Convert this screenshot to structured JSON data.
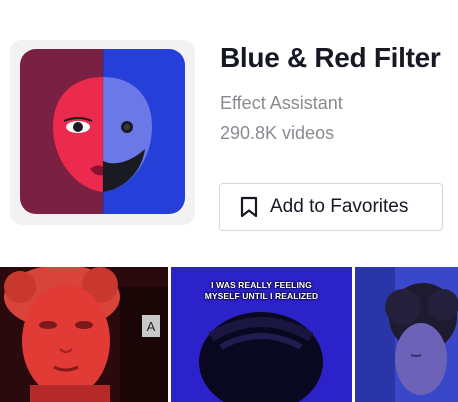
{
  "effect": {
    "title": "Blue & Red Filter",
    "creator": "Effect Assistant",
    "video_count": "290.8K videos",
    "icon": "red-blue-face-mask-icon"
  },
  "favorites_button": {
    "label": "Add to Favorites",
    "icon": "bookmark-icon"
  },
  "videos": [
    {
      "caption_lines": []
    },
    {
      "caption_lines": [
        "I WAS REALLY FEELING",
        "MYSELF UNTIL I REALIZED"
      ]
    },
    {
      "caption_lines": []
    }
  ],
  "colors": {
    "title": "#161823",
    "secondary_text": "#8a8b91",
    "icon_red": "#e0264a",
    "icon_blue": "#2e3fe0"
  }
}
